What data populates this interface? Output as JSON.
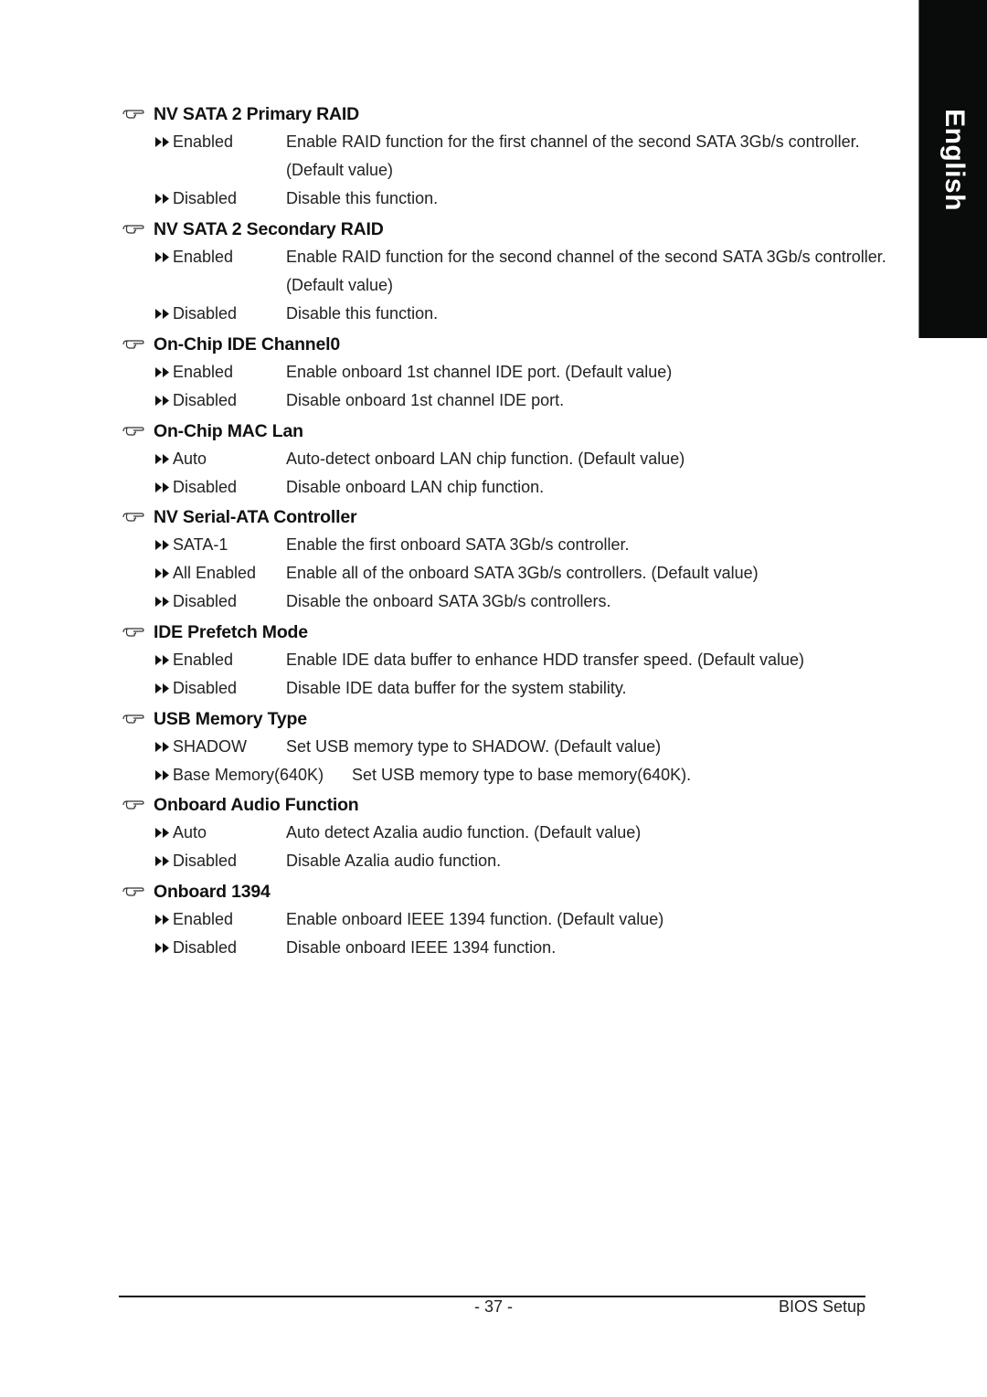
{
  "side_tab": {
    "label": "English",
    "background": "#0a0c0b"
  },
  "sections": [
    {
      "title": "NV SATA 2 Primary RAID",
      "options": [
        {
          "label": "Enabled",
          "desc": "Enable RAID function for the first channel of the second SATA 3Gb/s controller.",
          "desc_cont": "(Default value)"
        },
        {
          "label": "Disabled",
          "desc": "Disable this function."
        }
      ]
    },
    {
      "title": "NV SATA 2 Secondary RAID",
      "options": [
        {
          "label": "Enabled",
          "desc": "Enable RAID function for the second channel of the second SATA 3Gb/s controller.",
          "desc_cont": "(Default value)"
        },
        {
          "label": "Disabled",
          "desc": "Disable this function."
        }
      ]
    },
    {
      "title": "On-Chip IDE Channel0",
      "options": [
        {
          "label": "Enabled",
          "desc": "Enable onboard 1st channel IDE port. (Default value)"
        },
        {
          "label": "Disabled",
          "desc": "Disable onboard 1st channel IDE port."
        }
      ]
    },
    {
      "title": "On-Chip MAC Lan",
      "options": [
        {
          "label": "Auto",
          "desc": "Auto-detect onboard LAN chip function. (Default value)"
        },
        {
          "label": "Disabled",
          "desc": "Disable onboard LAN chip function."
        }
      ]
    },
    {
      "title": "NV Serial-ATA Controller",
      "options": [
        {
          "label": "SATA-1",
          "desc": "Enable the first onboard SATA 3Gb/s controller."
        },
        {
          "label": "All Enabled",
          "desc": "Enable all of the onboard SATA 3Gb/s controllers. (Default value)"
        },
        {
          "label": "Disabled",
          "desc": "Disable the onboard SATA 3Gb/s controllers."
        }
      ]
    },
    {
      "title": "IDE Prefetch Mode",
      "options": [
        {
          "label": "Enabled",
          "desc": "Enable IDE data buffer to enhance HDD transfer speed. (Default value)"
        },
        {
          "label": "Disabled",
          "desc": "Disable IDE data buffer for the system stability."
        }
      ]
    },
    {
      "title": "USB Memory Type",
      "options": [
        {
          "label": "SHADOW",
          "desc": "Set USB memory type to SHADOW. (Default value)"
        },
        {
          "label": "Base Memory(640K)",
          "desc": "Set USB memory type to base memory(640K)."
        }
      ]
    },
    {
      "title": "Onboard Audio Function",
      "options": [
        {
          "label": "Auto",
          "desc": "Auto detect Azalia audio function. (Default value)"
        },
        {
          "label": "Disabled",
          "desc": "Disable Azalia audio function."
        }
      ]
    },
    {
      "title": "Onboard 1394",
      "options": [
        {
          "label": "Enabled",
          "desc": "Enable onboard IEEE 1394 function. (Default value)"
        },
        {
          "label": "Disabled",
          "desc": "Disable onboard IEEE 1394 function."
        }
      ]
    }
  ],
  "footer": {
    "page_number": "- 37 -",
    "title": "BIOS Setup"
  },
  "icons": {
    "heading": "pointing-hand-icon",
    "option": "double-arrow-icon"
  }
}
